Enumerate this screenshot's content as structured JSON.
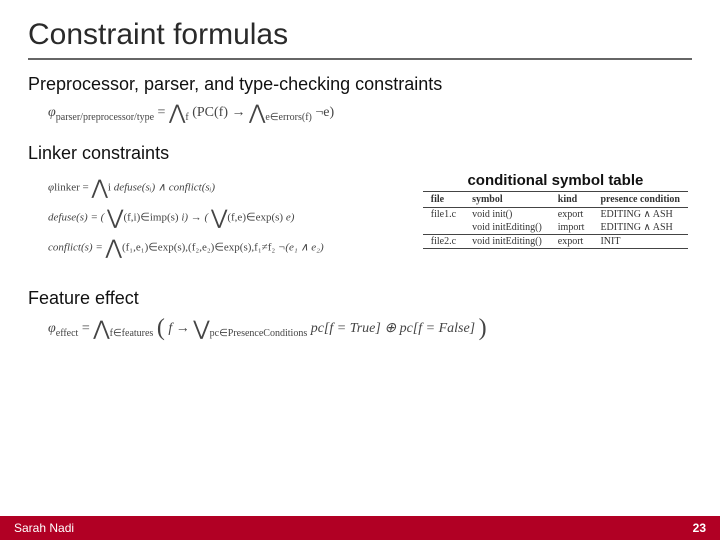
{
  "title": "Constraint formulas",
  "sections": {
    "s1": "Preprocessor, parser, and type-checking constraints",
    "s2": "Linker constraints",
    "s3": "Feature effect"
  },
  "formulas": {
    "phi_ppt_lhs": "φ",
    "phi_ppt_sub": "parser/preprocessor/type",
    "phi_ppt_rhs_a": "f",
    "phi_ppt_rhs_b": "(PC(f) → ",
    "phi_ppt_rhs_c": "e∈errors(f)",
    "phi_ppt_rhs_d": "¬e)",
    "linker_lhs": "φ",
    "linker_sub": "linker",
    "linker_rhs": " defuse(sᵢ) ∧ conflict(sᵢ)",
    "linker_rhs_sub": "i",
    "defuse_lhs": "defuse(s) = (",
    "defuse_mid": " i) → (",
    "defuse_end": " e)",
    "defuse_sub1": "(f,i)∈imp(s)",
    "defuse_sub2": "(f,e)∈exp(s)",
    "conflict_lhs": "conflict(s) = ",
    "conflict_rhs": " ¬(e₁ ∧ e₂)",
    "conflict_sub": "(f₁,e₁)∈exp(s),(f₂,e₂)∈exp(s),f₁≠f₂",
    "effect_lhs": "φ",
    "effect_sub": "effect",
    "effect_mid_sub": "f∈features",
    "effect_body_a": "f → ",
    "effect_body_sub": "pc∈PresenceConditions",
    "effect_body_b": " pc[f = True] ⊕ pc[f = False]"
  },
  "table": {
    "caption": "conditional symbol table",
    "headers": [
      "file",
      "symbol",
      "kind",
      "presence condition"
    ],
    "rows": [
      [
        "file1.c",
        "void init()",
        "export",
        "EDITING ∧ ASH"
      ],
      [
        "",
        "void initEditing()",
        "import",
        "EDITING ∧ ASH"
      ],
      [
        "file2.c",
        "void initEditing()",
        "export",
        "INIT"
      ]
    ]
  },
  "footer": {
    "author": "Sarah Nadi",
    "page": "23"
  },
  "colors": {
    "accent": "#b10024"
  }
}
